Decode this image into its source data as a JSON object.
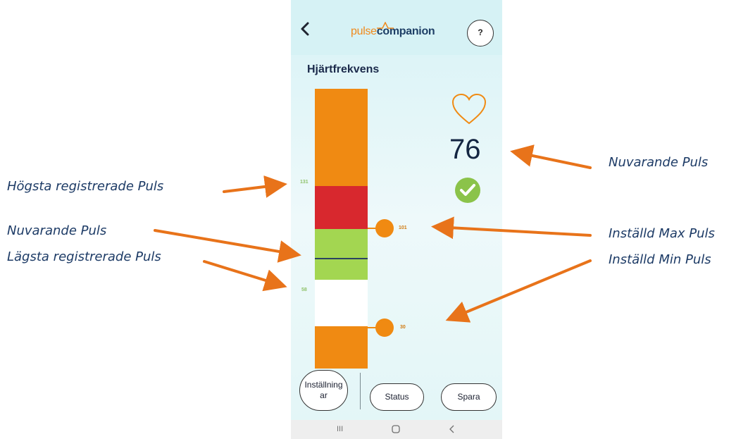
{
  "app": {
    "logo_part1": "pulse",
    "logo_part2": "companion",
    "back_icon": "chevron-left-icon",
    "help_label": "?"
  },
  "page": {
    "title": "Hjärtfrekvens"
  },
  "gauge": {
    "recorded_high": "131",
    "recorded_low": "58",
    "set_max": "101",
    "set_min": "30",
    "current_value": "76",
    "status_icon": "check-circle-icon",
    "heart_icon": "heart-icon",
    "colors": {
      "high_zone": "#f08a12",
      "alarm": "#d8282e",
      "normal": "#a3d651",
      "low_zone": "#ffffff",
      "check": "#8bc34a"
    }
  },
  "buttons": {
    "settings_line1": "Inställning",
    "settings_line2": "ar",
    "status": "Status",
    "save": "Spara"
  },
  "nav": {
    "recent": "III",
    "home": "O",
    "back": "<"
  },
  "annotations": {
    "left_top": "Högsta registrerade Puls",
    "left_mid": "Nuvarande Puls",
    "left_bottom": "Lägsta registrerade Puls",
    "right_top": "Nuvarande Puls",
    "right_mid": "Inställd Max Puls",
    "right_bottom": "Inställd Min Puls"
  }
}
